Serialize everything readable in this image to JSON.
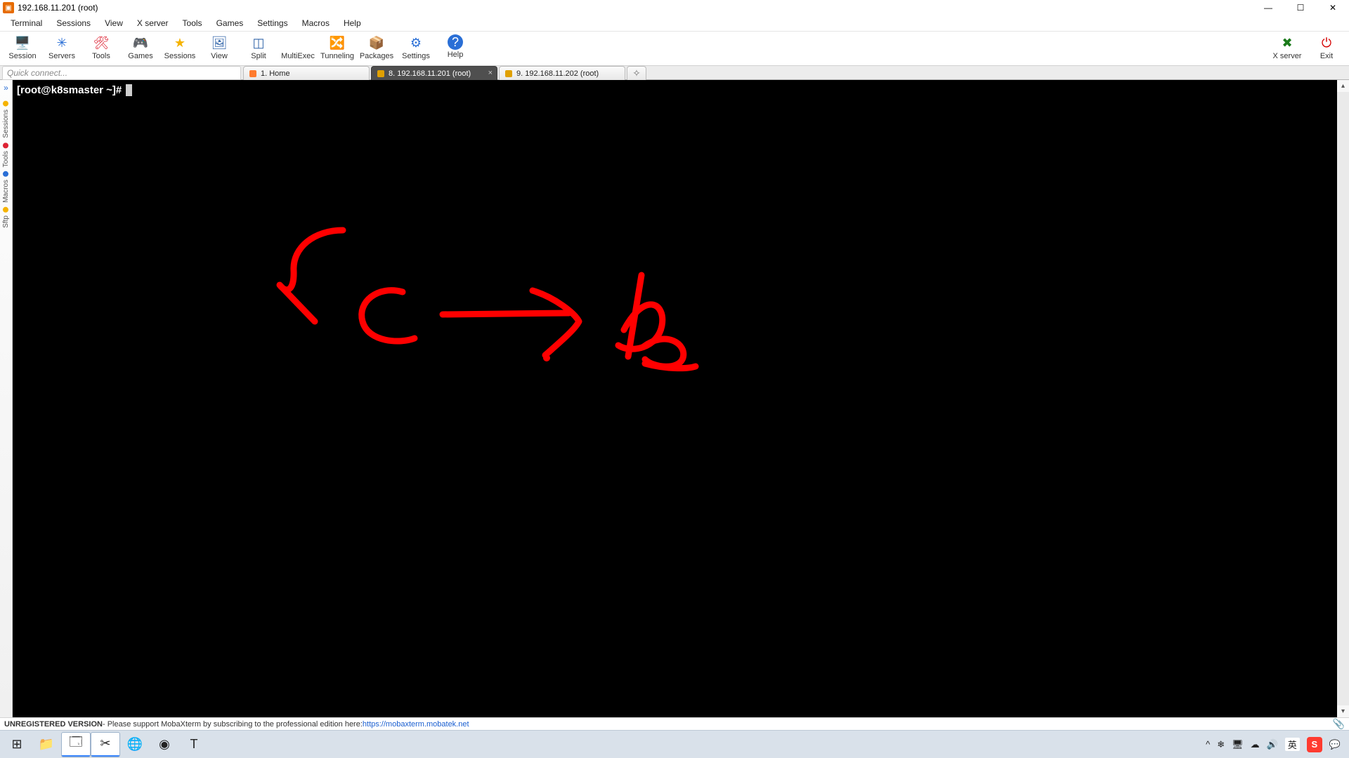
{
  "titlebar": {
    "title": "192.168.11.201 (root)"
  },
  "menubar": [
    "Terminal",
    "Sessions",
    "View",
    "X server",
    "Tools",
    "Games",
    "Settings",
    "Macros",
    "Help"
  ],
  "toolbar": [
    {
      "name": "session",
      "label": "Session",
      "icon": "🖥️",
      "color": "#2a8"
    },
    {
      "name": "servers",
      "label": "Servers",
      "icon": "✳",
      "color": "#2a6fd6"
    },
    {
      "name": "tools",
      "label": "Tools",
      "icon": "🛠",
      "color": "#d23"
    },
    {
      "name": "games",
      "label": "Games",
      "icon": "🎮",
      "color": "#6a4"
    },
    {
      "name": "sessions",
      "label": "Sessions",
      "icon": "★",
      "color": "#f5b301"
    },
    {
      "name": "view",
      "label": "View",
      "icon": "🖼",
      "color": "#36a"
    },
    {
      "name": "split",
      "label": "Split",
      "icon": "◫",
      "color": "#36a"
    },
    {
      "name": "multiexec",
      "label": "MultiExec",
      "icon": "⵬",
      "color": "#71c"
    },
    {
      "name": "tunneling",
      "label": "Tunneling",
      "icon": "🔀",
      "color": "#777"
    },
    {
      "name": "packages",
      "label": "Packages",
      "icon": "📦",
      "color": "#b87"
    },
    {
      "name": "settings",
      "label": "Settings",
      "icon": "⚙",
      "color": "#2a6fd6"
    },
    {
      "name": "help",
      "label": "Help",
      "icon": "?",
      "color": "#fff",
      "bg": "#2a6fd6"
    }
  ],
  "toolbar_right": [
    {
      "name": "xserver",
      "label": "X server",
      "icon": "✖",
      "color": "#1a7a1a"
    },
    {
      "name": "exit",
      "label": "Exit",
      "icon": "⏻",
      "color": "#d40000"
    }
  ],
  "quick_connect_placeholder": "Quick connect...",
  "tabs": [
    {
      "name": "home",
      "label": "1. Home",
      "kind": "home",
      "active": false
    },
    {
      "name": "t201",
      "label": "8. 192.168.11.201 (root)",
      "kind": "term",
      "active": true
    },
    {
      "name": "t202",
      "label": "9. 192.168.11.202 (root)",
      "kind": "term",
      "active": false
    }
  ],
  "sidebar": [
    {
      "name": "sessions",
      "label": "Sessions",
      "color": "#f5b301"
    },
    {
      "name": "tools",
      "label": "Tools",
      "color": "#d23"
    },
    {
      "name": "macros",
      "label": "Macros",
      "color": "#2a6fd6"
    },
    {
      "name": "sftp",
      "label": "Sftp",
      "color": "#f5b301"
    }
  ],
  "terminal": {
    "prompt": "[root@k8smaster ~]# "
  },
  "status": {
    "unreg": "UNREGISTERED VERSION",
    "msg": " -  Please support MobaXterm by subscribing to the professional edition here:  ",
    "link_text": "https://mobaxterm.mobatek.net",
    "link_href": "https://mobaxterm.mobatek.net"
  },
  "taskbar": {
    "apps": [
      {
        "name": "start",
        "icon": "⊞",
        "active": false
      },
      {
        "name": "explorer",
        "icon": "📁",
        "active": false
      },
      {
        "name": "vm",
        "icon": "🗔",
        "active": true
      },
      {
        "name": "snip",
        "icon": "✂",
        "active": true
      },
      {
        "name": "edge",
        "icon": "🌐",
        "active": false
      },
      {
        "name": "chrome",
        "icon": "◉",
        "active": false
      },
      {
        "name": "text",
        "icon": "T",
        "active": false
      }
    ],
    "tray": {
      "chev": "^",
      "icons": [
        "❄",
        "🖥",
        "☁",
        "🔊"
      ],
      "ime1": "英",
      "ime2": "S",
      "msg": "💬"
    }
  }
}
